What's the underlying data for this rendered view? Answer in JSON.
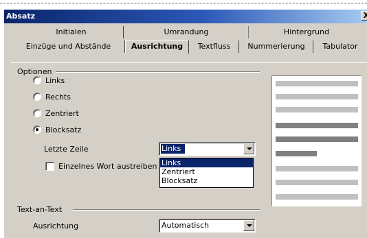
{
  "dialog": {
    "title": "Absatz",
    "close_label": "X"
  },
  "tabs_row1": [
    "Initialen",
    "Umrandung",
    "Hintergrund"
  ],
  "tabs_row2": [
    "Einzüge und Abstände",
    "Ausrichtung",
    "Textfluss",
    "Nummerierung",
    "Tabulator"
  ],
  "active_tab": "Ausrichtung",
  "options": {
    "group_label": "Optionen",
    "radios": [
      {
        "label": "Links",
        "checked": false
      },
      {
        "label": "Rechts",
        "checked": false
      },
      {
        "label": "Zentriert",
        "checked": false
      },
      {
        "label": "Blocksatz",
        "checked": true
      }
    ],
    "last_line_label": "Letzte Zeile",
    "last_line_value": "Links",
    "last_line_options": [
      "Links",
      "Zentriert",
      "Blocksatz"
    ],
    "last_line_highlighted": "Links",
    "single_word_label": "Einzelnes Wort austreiben",
    "single_word_checked": false
  },
  "text_to_text": {
    "group_label": "Text-an-Text",
    "alignment_label": "Ausrichtung",
    "alignment_value": "Automatisch"
  },
  "colors": {
    "title_gradient_start": "#0a246a",
    "selection": "#0a246a",
    "dialog_face": "#d4d0c8",
    "preview_line": "#c0c0c0",
    "preview_line_active": "#808080"
  }
}
